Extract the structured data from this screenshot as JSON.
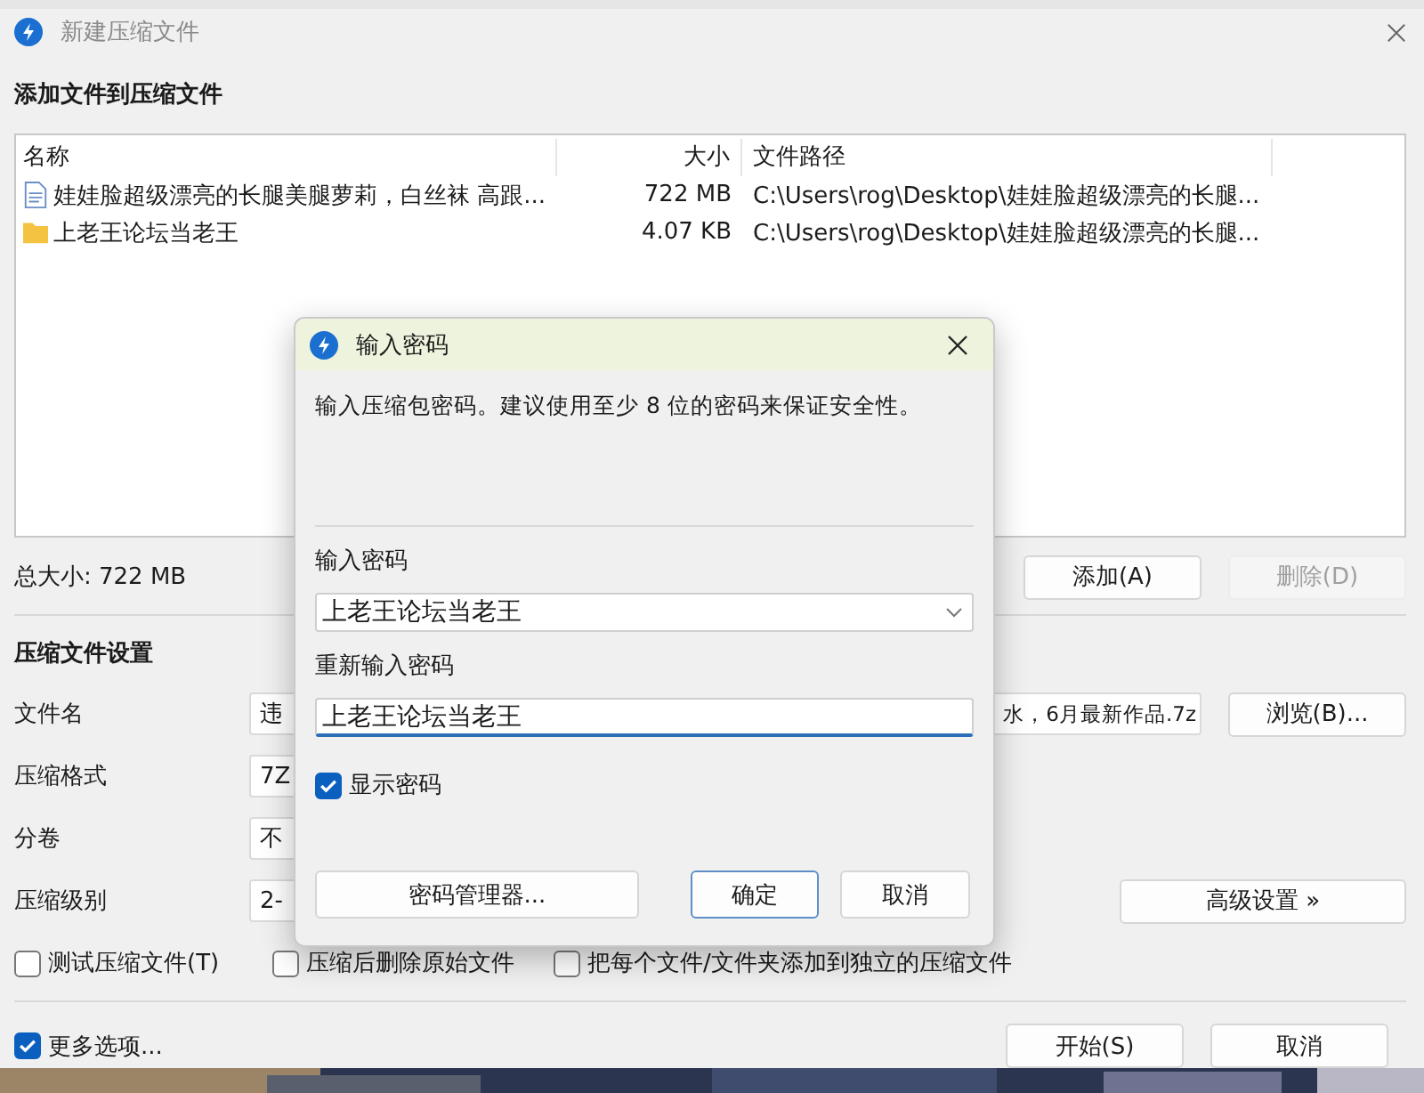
{
  "window": {
    "title": "新建压缩文件"
  },
  "files_section": {
    "heading": "添加文件到压缩文件",
    "columns": [
      "名称",
      "大小",
      "文件路径"
    ],
    "rows": [
      {
        "kind": "file",
        "name": "娃娃脸超级漂亮的长腿美腿萝莉，白丝袜 高跟...",
        "size": "722 MB",
        "path": "C:\\Users\\rog\\Desktop\\娃娃脸超级漂亮的长腿..."
      },
      {
        "kind": "folder",
        "name": "上老王论坛当老王",
        "size": "4.07 KB",
        "path": "C:\\Users\\rog\\Desktop\\娃娃脸超级漂亮的长腿..."
      }
    ],
    "total": "总大小: 722 MB",
    "buttons": [
      {
        "label": "添加(A)",
        "disabled": false
      },
      {
        "label": "删除(D)",
        "disabled": true
      }
    ]
  },
  "settings": {
    "heading": "压缩文件设置",
    "fields": [
      {
        "label": "文件名",
        "value": "违",
        "value_end": "水，6月最新作品.7z",
        "button": "浏览(B)..."
      },
      {
        "label": "压缩格式",
        "value": "7Z"
      },
      {
        "label": "分卷",
        "value": "不"
      },
      {
        "label": "压缩级别",
        "value": "2-",
        "button": "高级设置 »"
      }
    ],
    "options": [
      {
        "label": "测试压缩文件(T)",
        "checked": false
      },
      {
        "label": "压缩后删除原始文件",
        "checked": false
      },
      {
        "label": "把每个文件/文件夹添加到独立的压缩文件",
        "checked": false
      }
    ]
  },
  "more_options": {
    "label": "更多选项...",
    "checked": true
  },
  "buttons": [
    "开始(S)",
    "取消"
  ],
  "dialog": {
    "title": "输入密码",
    "message": "输入压缩包密码。建议使用至少 8 位的密码来保证安全性。",
    "password_label": "输入密码",
    "password": "上老王论坛当老王",
    "confirm_label": "重新输入密码",
    "confirm": "上老王论坛当老王",
    "show_password": {
      "label": "显示密码",
      "checked": true
    },
    "buttons": [
      {
        "label": "密码管理器...",
        "kind": "manager"
      },
      {
        "label": "确定",
        "kind": "default"
      },
      {
        "label": "取消",
        "kind": "cancel"
      }
    ]
  }
}
